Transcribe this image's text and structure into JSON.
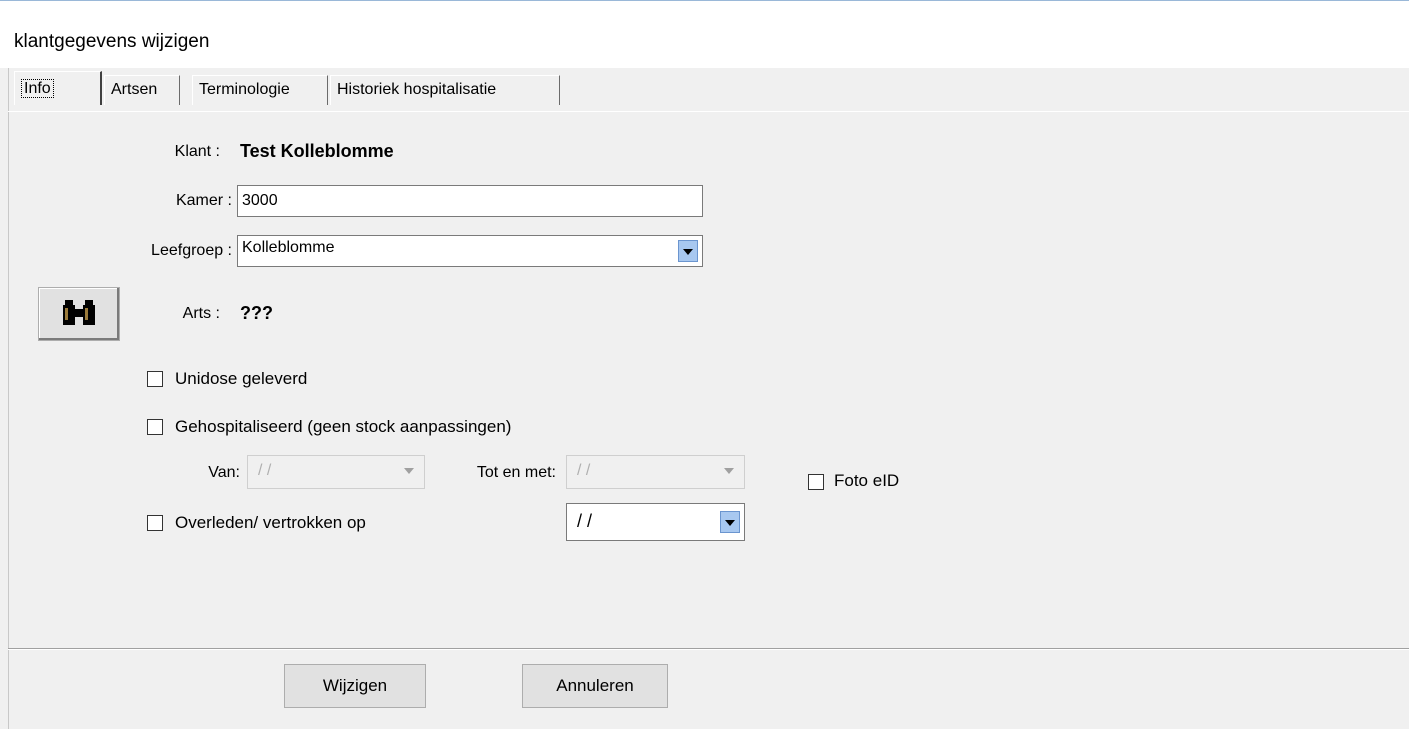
{
  "window": {
    "title": "klantgegevens wijzigen"
  },
  "tabs": [
    {
      "label": "Info"
    },
    {
      "label": "Artsen"
    },
    {
      "label": "Terminologie"
    },
    {
      "label": "Historiek hospitalisatie"
    }
  ],
  "form": {
    "klant_label": "Klant :",
    "klant_value": "Test Kolleblomme",
    "kamer_label": "Kamer :",
    "kamer_value": "3000",
    "leefgroep_label": "Leefgroep :",
    "leefgroep_value": "Kolleblomme",
    "arts_label": "Arts :",
    "arts_value": "???",
    "search_icon": "binoculars-icon",
    "unidose_label": "Unidose geleverd",
    "gehospitaliseerd_label": "Gehospitaliseerd (geen stock aanpassingen)",
    "van_label": "Van:",
    "van_value": "/ /",
    "tot_label": "Tot en met:",
    "tot_value": "/ /",
    "foto_label": "Foto eID",
    "overleden_label": "Overleden/ vertrokken op",
    "overleden_value": "/ /"
  },
  "buttons": {
    "wijzigen": "Wijzigen",
    "annuleren": "Annuleren"
  },
  "colors": {
    "combo_arrow": "#a8c8f0",
    "face": "#f0f0f0"
  }
}
